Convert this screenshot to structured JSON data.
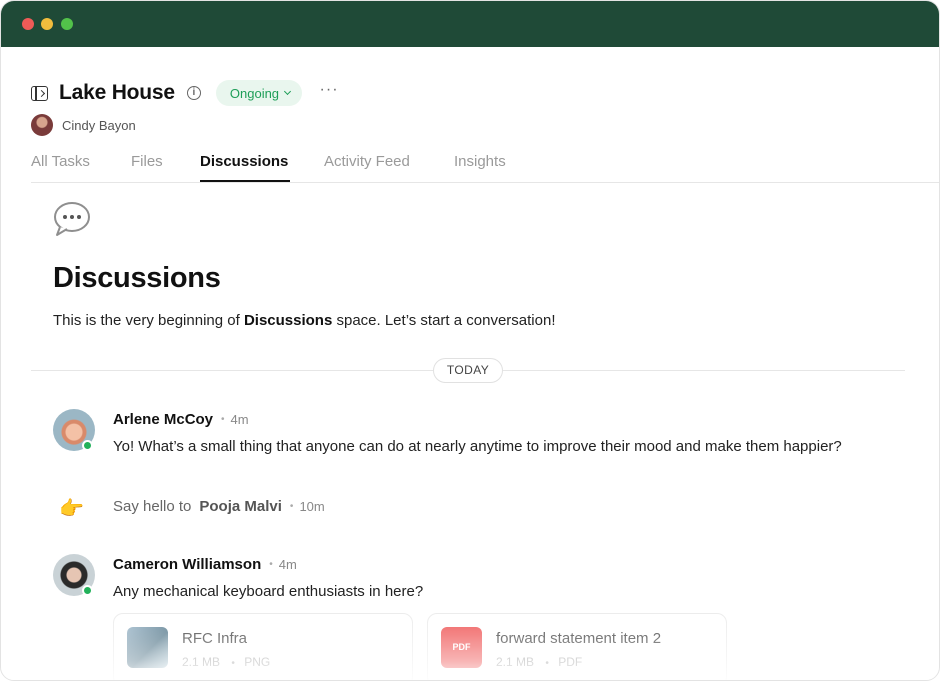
{
  "window": {
    "title_bar_color": "#1f4a37"
  },
  "header": {
    "title": "Lake House",
    "status": "Ongoing",
    "status_color": "#1e9e58",
    "more_label": "···"
  },
  "owner": {
    "name": "Cindy Bayon"
  },
  "tabs": [
    {
      "label": "All Tasks"
    },
    {
      "label": "Files"
    },
    {
      "label": "Discussions"
    },
    {
      "label": "Activity Feed"
    },
    {
      "label": "Insights"
    }
  ],
  "active_tab": "Discussions",
  "section": {
    "title": "Discussions",
    "intro_prefix": "This is the very beginning of ",
    "intro_bold": "Discussions",
    "intro_suffix": " space. Let’s start a conversation!"
  },
  "day_label": "TODAY",
  "messages": [
    {
      "author": "Arlene McCoy",
      "time": "4m",
      "text": "Yo! What’s a small thing that anyone can do at nearly anytime to improve their mood and make them happier?"
    },
    {
      "author": "Cameron Williamson",
      "time": "4m",
      "text": "Any mechanical keyboard enthusiasts in here?"
    }
  ],
  "system_event": {
    "icon": "pointing-hand-icon",
    "prefix": "Say hello to",
    "name": "Pooja Malvi",
    "time": "10m"
  },
  "attachments": [
    {
      "name": "RFC Infra",
      "size": "2.1 MB",
      "type": "PNG"
    },
    {
      "name": "forward statement item 2",
      "size": "2.1 MB",
      "type": "PDF"
    }
  ],
  "pdf_badge": "PDF",
  "separator": "•"
}
